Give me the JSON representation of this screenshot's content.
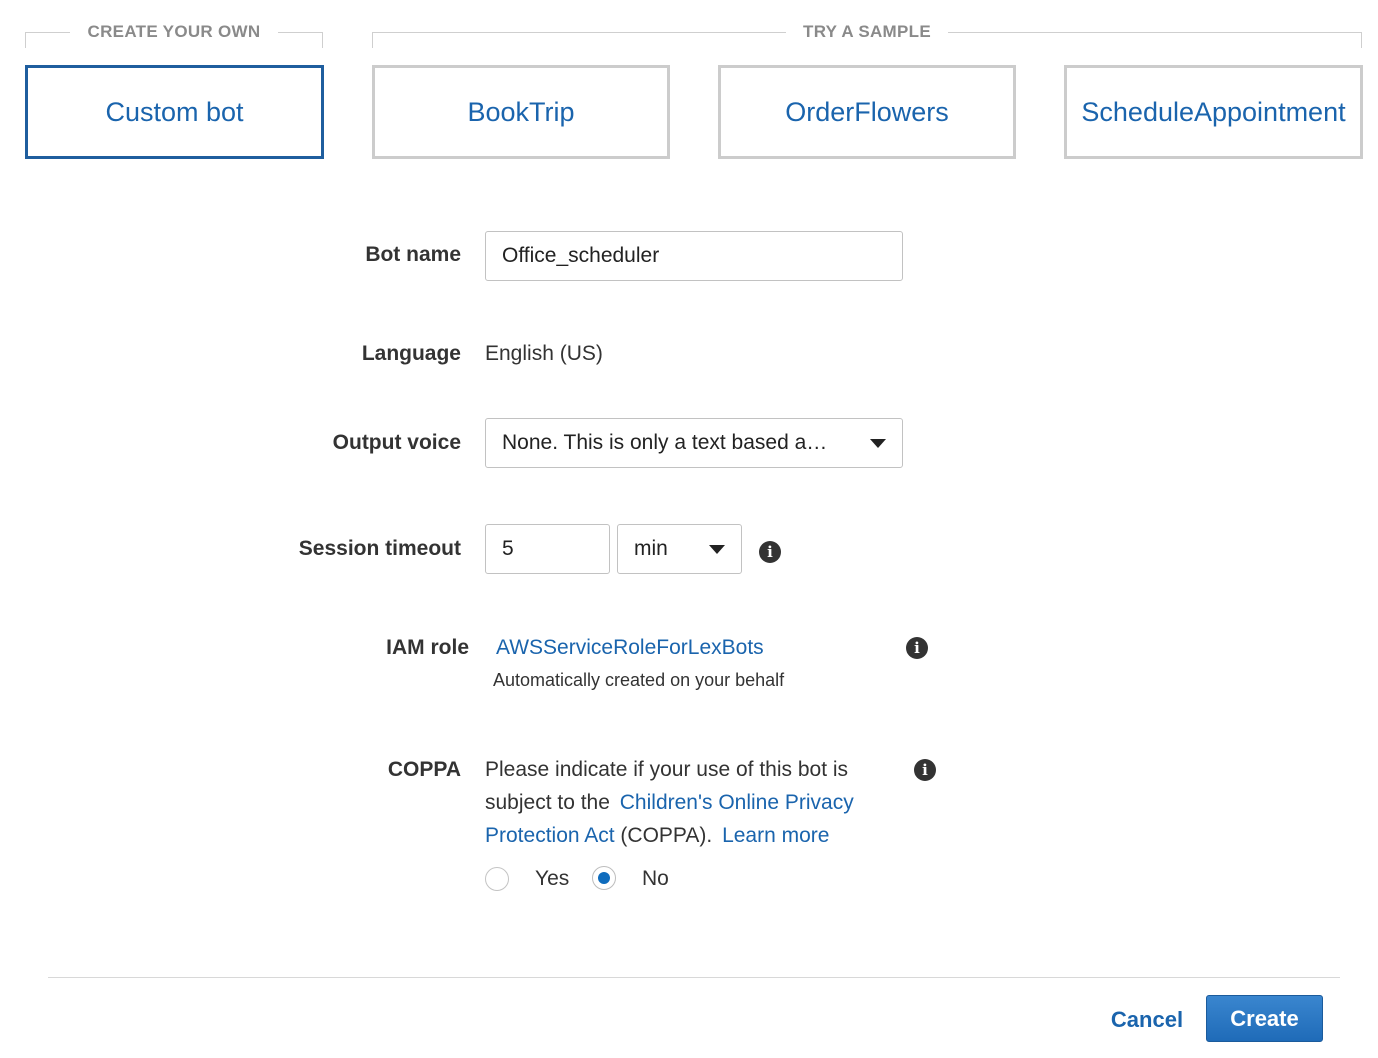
{
  "sections": {
    "create_your_own": "CREATE YOUR OWN",
    "try_a_sample": "TRY A SAMPLE"
  },
  "cards": [
    {
      "label": "Custom bot",
      "selected": true
    },
    {
      "label": "BookTrip",
      "selected": false
    },
    {
      "label": "OrderFlowers",
      "selected": false
    },
    {
      "label": "ScheduleAppointment",
      "selected": false
    }
  ],
  "form": {
    "bot_name": {
      "label": "Bot name",
      "value": "Office_scheduler"
    },
    "language": {
      "label": "Language",
      "value": "English (US)"
    },
    "output_voice": {
      "label": "Output voice",
      "value": "None. This is only a text based a…"
    },
    "session_timeout": {
      "label": "Session timeout",
      "value": "5",
      "unit": "min"
    },
    "iam_role": {
      "label": "IAM role",
      "value": "AWSServiceRoleForLexBots",
      "note": "Automatically created on your behalf"
    },
    "coppa": {
      "label": "COPPA",
      "text_1": "Please indicate if your use of this bot is",
      "text_2": "subject to the",
      "link_1": "Children's Online Privacy",
      "link_2": "Protection Act",
      "text_3": "(COPPA).",
      "learn_more": "Learn more",
      "options": [
        {
          "label": "Yes",
          "checked": false
        },
        {
          "label": "No",
          "checked": true
        }
      ]
    }
  },
  "footer": {
    "cancel": "Cancel",
    "create": "Create"
  },
  "colors": {
    "link": "#1a64ad",
    "primary_button": "#1f6bb8",
    "selected_border": "#1f5e9e",
    "radio_checked": "#0f6cbd"
  },
  "icons": {
    "info": "info-icon",
    "dropdown": "caret-down-icon"
  }
}
